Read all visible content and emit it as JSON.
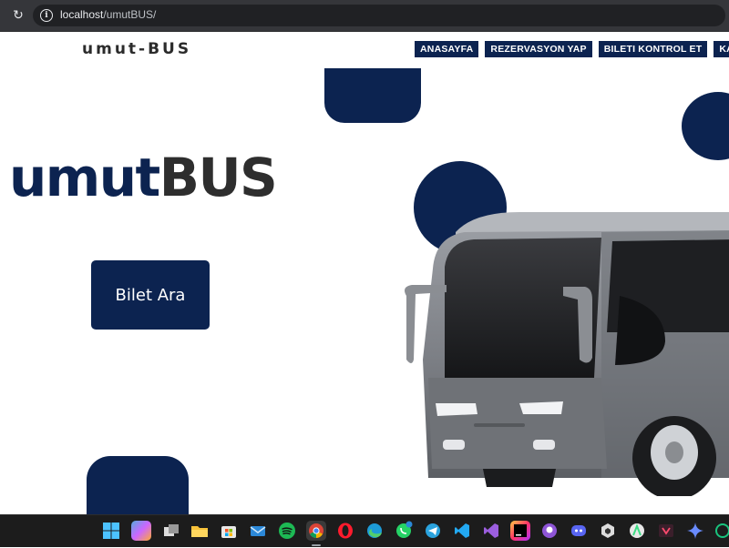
{
  "browser": {
    "url_host": "localhost",
    "url_path": "/umutBUS/"
  },
  "header": {
    "logo": "umut-BUS",
    "nav": [
      "ANASAYFA",
      "REZERVASYON YAP",
      "BILETI KONTROL ET",
      "KAYIT OL"
    ]
  },
  "hero": {
    "title_part1": "umut",
    "title_part2": "BUS",
    "button_label": "Bilet Ara"
  },
  "colors": {
    "brand_navy": "#0c2350",
    "title_dark": "#2e2e2e"
  },
  "taskbar": {
    "icons": [
      "windows-start-icon",
      "copilot-icon",
      "task-view-icon",
      "file-explorer-icon",
      "microsoft-store-icon",
      "mail-icon",
      "spotify-icon",
      "chrome-icon",
      "opera-icon",
      "edge-icon",
      "whatsapp-icon",
      "telegram-icon",
      "vscode-icon",
      "visual-studio-icon",
      "jetbrains-icon",
      "github-desktop-icon",
      "discord-icon",
      "unity-icon",
      "android-studio-icon",
      "figma-icon",
      "gemini-icon",
      "chatgpt-icon"
    ]
  }
}
